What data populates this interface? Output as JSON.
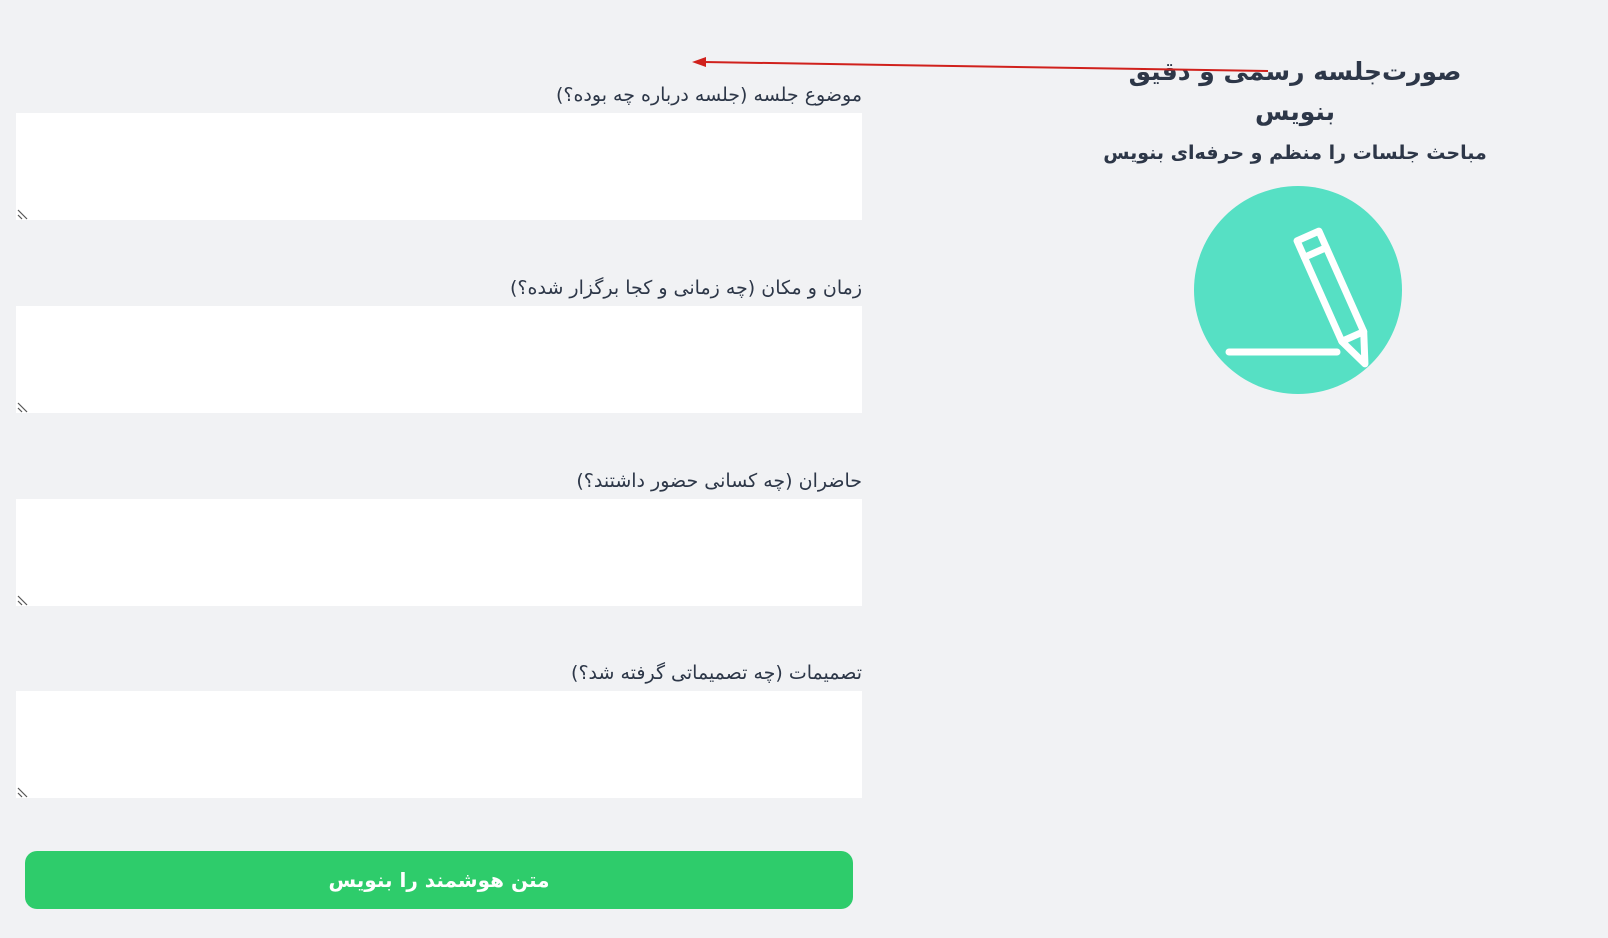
{
  "hero": {
    "title": "صورت‌جلسه رسمی و دقیق بنویس",
    "subtitle": "مباحث جلسات را منظم و حرفه‌ای بنویس",
    "icon": "pencil-icon",
    "badge_color": "#56e0c4"
  },
  "form": {
    "fields": [
      {
        "label": "موضوع جلسه (جلسه درباره چه بوده؟)",
        "value": "",
        "placeholder": ""
      },
      {
        "label": "زمان و مکان (چه زمانی و کجا برگزار شده؟)",
        "value": "",
        "placeholder": ""
      },
      {
        "label": "حاضران (چه کسانی حضور داشتند؟)",
        "value": "",
        "placeholder": ""
      },
      {
        "label": "تصمیمات (چه تصمیماتی گرفته شد؟)",
        "value": "",
        "placeholder": ""
      }
    ],
    "submit_label": "متن هوشمند را بنویس"
  },
  "colors": {
    "background": "#f1f2f4",
    "accent": "#2ecc6b",
    "annotation_arrow": "#d0211c"
  }
}
